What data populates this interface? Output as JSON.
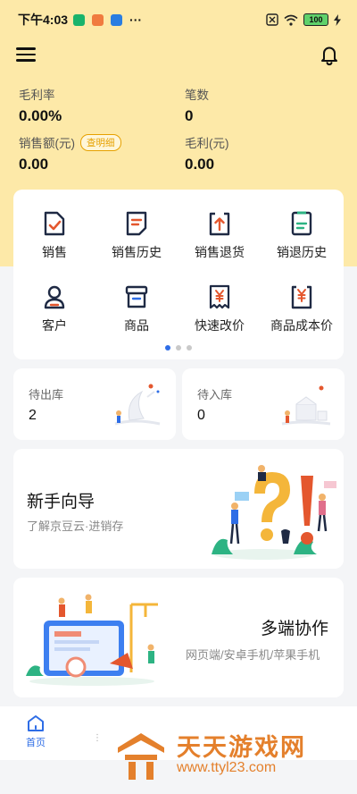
{
  "status_bar": {
    "time": "下午4:03",
    "more": "···",
    "battery": "100"
  },
  "stats": {
    "gross_margin_rate": {
      "label": "毛利率",
      "value": "0.00%"
    },
    "order_count": {
      "label": "笔数",
      "value": "0"
    },
    "sales_amount": {
      "label": "销售额(元)",
      "value": "0.00",
      "detail_button": "查明细"
    },
    "gross_profit": {
      "label": "毛利(元)",
      "value": "0.00"
    }
  },
  "menu": {
    "items": [
      {
        "label": "销售",
        "icon": "sales-doc-check-icon"
      },
      {
        "label": "销售历史",
        "icon": "sales-history-icon"
      },
      {
        "label": "销售退货",
        "icon": "sales-return-icon"
      },
      {
        "label": "销退历史",
        "icon": "return-history-icon"
      },
      {
        "label": "客户",
        "icon": "customer-icon"
      },
      {
        "label": "商品",
        "icon": "product-box-icon"
      },
      {
        "label": "快速改价",
        "icon": "quick-price-icon"
      },
      {
        "label": "商品成本价",
        "icon": "product-cost-icon"
      }
    ],
    "page_count": 3,
    "active_page": 1
  },
  "stock": {
    "outbound": {
      "label": "待出库",
      "value": "2"
    },
    "inbound": {
      "label": "待入库",
      "value": "0"
    }
  },
  "banners": {
    "guide": {
      "title": "新手向导",
      "subtitle": "了解京豆云·进销存"
    },
    "multi": {
      "title": "多端协作",
      "subtitle": "网页端/安卓手机/苹果手机"
    }
  },
  "tabbar": {
    "home": "首页",
    "dots": "⋮"
  },
  "watermark": {
    "name": "天天游戏网",
    "url": "www.ttyl23.com"
  },
  "colors": {
    "hero_bg": "#fde9a8",
    "accent_blue": "#2e6de6",
    "icon_red": "#e4572e",
    "icon_navy": "#1f2a44",
    "badge_orange": "#e6a100"
  }
}
